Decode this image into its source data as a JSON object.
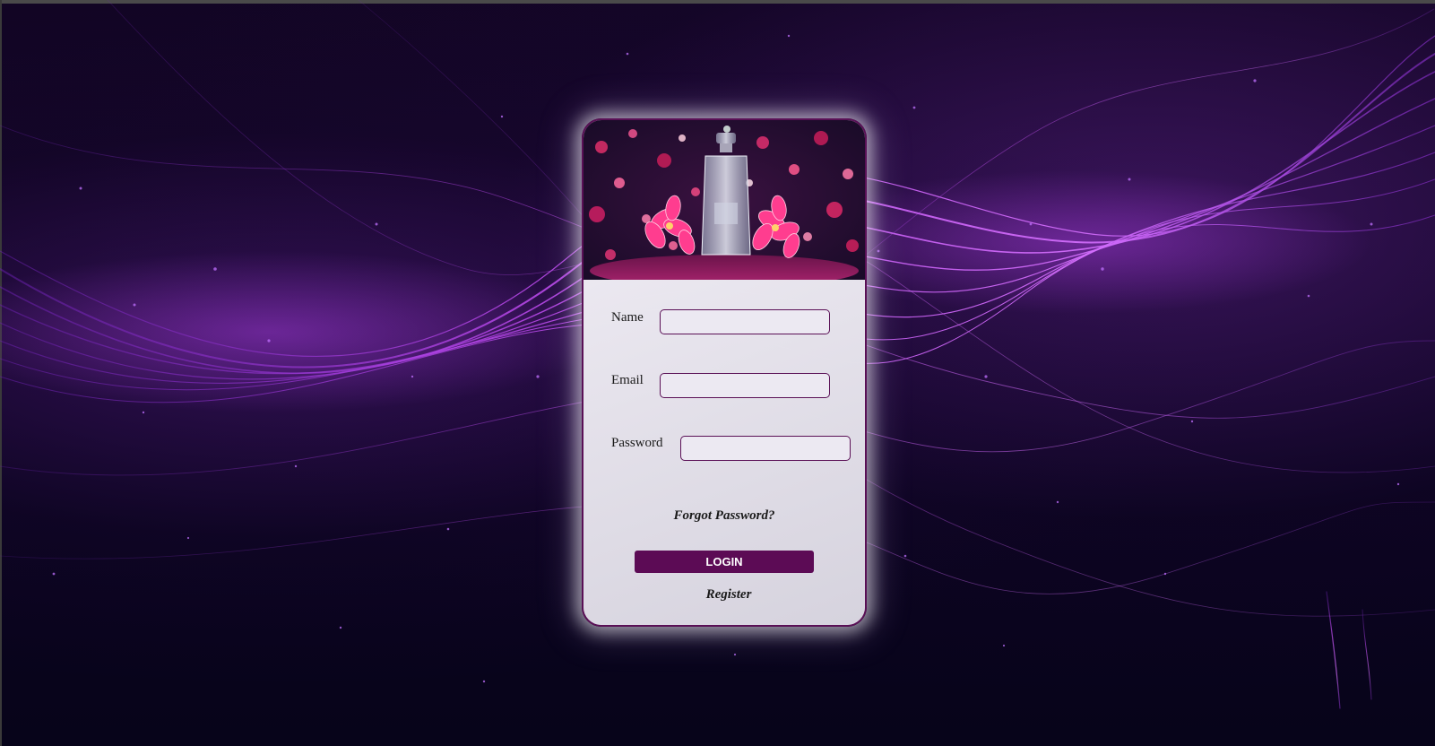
{
  "login_form": {
    "name_label": "Name",
    "email_label": "Email",
    "password_label": "Password",
    "name_value": "",
    "email_value": "",
    "password_value": "",
    "forgot_password_link": "Forgot Password?",
    "login_button": "LOGIN",
    "register_link": "Register"
  },
  "hero_image": {
    "icon": "perfume-bottle-with-flowers"
  },
  "colors": {
    "accent": "#5c0b55",
    "card_border": "#5a1056",
    "background": "#0c0420",
    "wave_purple": "#a23de0"
  }
}
